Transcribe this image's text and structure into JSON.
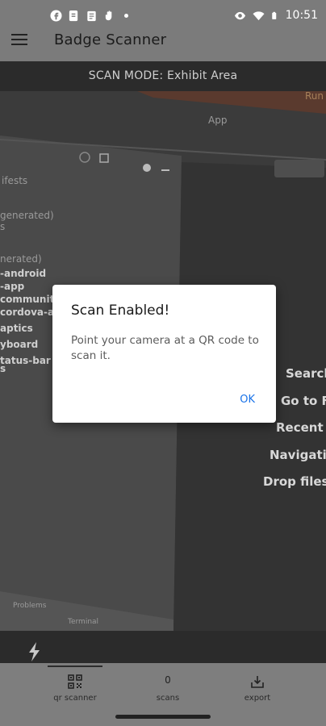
{
  "status_bar": {
    "time": "10:51",
    "left_icons": [
      "facebook-icon",
      "document-icon",
      "clipboard-icon",
      "hand-icon",
      "dot-icon"
    ],
    "right_icons": [
      "eye-icon",
      "wifi-icon",
      "battery-icon"
    ]
  },
  "app_bar": {
    "title": "Badge Scanner",
    "menu_icon": "hamburger-icon"
  },
  "mode_bar": {
    "text": "SCAN MODE: Exhibit Area"
  },
  "camera": {
    "background_texts": [
      "Run",
      "App",
      "ifests",
      "generated)",
      "s",
      "nerated)",
      "-android",
      "-app",
      "community-",
      "cordova-and",
      "aptics",
      "yboard",
      "tatus-bar",
      "s",
      "app",
      "Search",
      "Go to Fi",
      "Recent F",
      "Navigation",
      "Drop files h",
      "Problems",
      "Terminal"
    ]
  },
  "dialog": {
    "title": "Scan Enabled!",
    "message": "Point your camera at a QR code to scan it.",
    "ok_label": "OK"
  },
  "flash": {
    "icon": "flash-icon"
  },
  "bottom_nav": {
    "items": [
      {
        "label": "qr scanner",
        "icon": "qr-code-icon",
        "active": true
      },
      {
        "label": "scans",
        "count": "0",
        "active": false
      },
      {
        "label": "export",
        "icon": "export-icon",
        "active": false
      }
    ]
  },
  "colors": {
    "accent": "#1a73e8",
    "status_bar": "#7b7b7b",
    "mode_bar": "#2b2b2b",
    "nav_bar": "#7e7e7e"
  }
}
